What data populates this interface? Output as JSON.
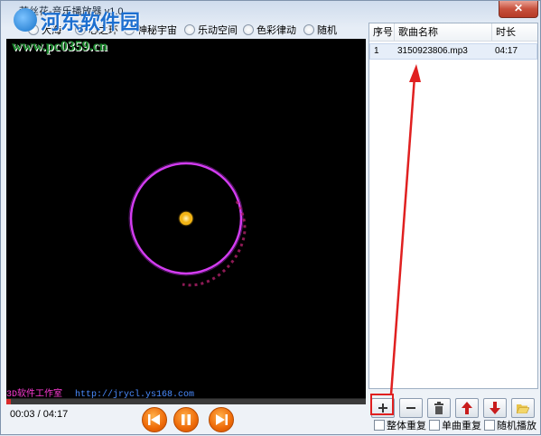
{
  "window": {
    "title": "荒丝花-音乐播放器 v1.0",
    "close_label": "✕"
  },
  "watermark": {
    "name": "河东软件园",
    "url": "www.pc0359.cn"
  },
  "modes": [
    {
      "label": "大海",
      "selected": false
    },
    {
      "label": "心之环",
      "selected": true
    },
    {
      "label": "神秘宇宙",
      "selected": false
    },
    {
      "label": "乐动空间",
      "selected": false
    },
    {
      "label": "色彩律动",
      "selected": false
    },
    {
      "label": "随机",
      "selected": false
    }
  ],
  "visualizer": {
    "studio": "3D软件工作室",
    "url": "http://jrycl.ys168.com"
  },
  "player": {
    "time": "00:03 / 04:17",
    "progress": 0.012
  },
  "playlist": {
    "headers": [
      "序号",
      "歌曲名称",
      "时长"
    ],
    "rows": [
      {
        "index": "1",
        "name": "3150923806.mp3",
        "duration": "04:17"
      }
    ]
  },
  "toolbar": {
    "add": "add",
    "remove": "remove",
    "delete": "trash",
    "up": "move-up",
    "down": "move-down",
    "open": "open-folder"
  },
  "options": [
    {
      "label": "整体重复",
      "checked": false
    },
    {
      "label": "单曲重复",
      "checked": false
    },
    {
      "label": "随机播放",
      "checked": false
    }
  ],
  "colors": {
    "accent_red": "#e02020",
    "button_orange": "#ee6a08",
    "ring_magenta": "#d23cf0"
  }
}
